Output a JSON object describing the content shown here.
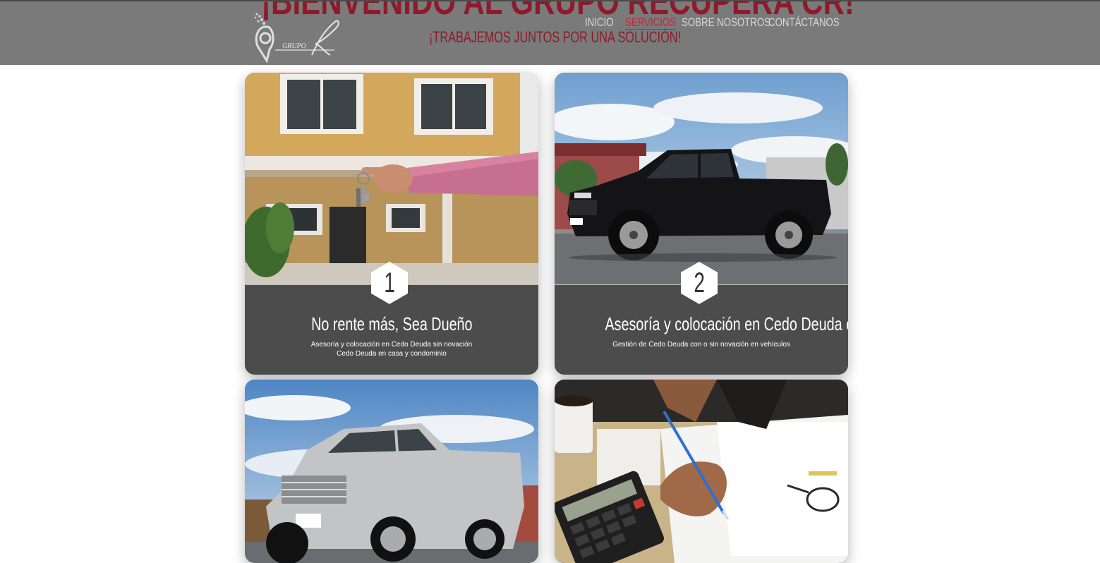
{
  "header": {
    "big_title": "¡BIENVENIDO AL GRUPO RECUPERA CR!",
    "subtitle": "¡TRABAJEMOS JUNTOS POR UNA SOLUCIÓN!",
    "logo_text": "GRUPO R",
    "nav": [
      {
        "label": "INICIO",
        "active": false
      },
      {
        "label": "SERVICIOS",
        "active": true
      },
      {
        "label": "SOBRE NOSOTROS",
        "active": false
      },
      {
        "label": "CONTÁCTANOS",
        "active": false
      }
    ]
  },
  "cards": [
    {
      "number": "1",
      "title": "No rente más, Sea Dueño",
      "desc_line1": "Asesoría y colocación en Cedo Deuda sin novación",
      "desc_line2": "Cedo Deuda en casa y condominio"
    },
    {
      "number": "2",
      "title": "Asesoría y colocación en Cedo Deuda en vehículos",
      "desc_line1": "Gestión de Cedo Deuda con o sin novación en vehículos",
      "desc_line2": ""
    },
    {
      "number": "",
      "title": "",
      "desc_line1": "",
      "desc_line2": ""
    },
    {
      "number": "",
      "title": "",
      "desc_line1": "",
      "desc_line2": ""
    }
  ],
  "colors": {
    "header_bg": "#7a7a7a",
    "accent_red": "#c2263a",
    "card_footer": "#4d4c4c"
  }
}
